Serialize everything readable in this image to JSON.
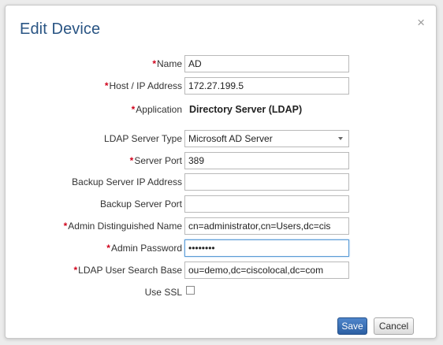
{
  "dialog": {
    "title": "Edit Device",
    "close_symbol": "×"
  },
  "required_marker": "*",
  "fields": {
    "name": {
      "label": "Name",
      "required": true,
      "value": "AD"
    },
    "host": {
      "label": "Host / IP Address",
      "required": true,
      "value": "172.27.199.5"
    },
    "application": {
      "label": "Application",
      "required": true,
      "value": "Directory Server (LDAP)"
    },
    "ldap_type": {
      "label": "LDAP Server Type",
      "required": false,
      "value": "Microsoft AD Server"
    },
    "server_port": {
      "label": "Server Port",
      "required": true,
      "value": "389"
    },
    "backup_ip": {
      "label": "Backup Server IP Address",
      "required": false,
      "value": ""
    },
    "backup_port": {
      "label": "Backup Server Port",
      "required": false,
      "value": ""
    },
    "admin_dn": {
      "label": "Admin Distinguished Name",
      "required": true,
      "value": "cn=administrator,cn=Users,dc=cis"
    },
    "admin_password": {
      "label": "Admin Password",
      "required": true,
      "value": "Passw0rd"
    },
    "search_base": {
      "label": "LDAP User Search Base",
      "required": true,
      "value": "ou=demo,dc=ciscolocal,dc=com"
    },
    "use_ssl": {
      "label": "Use SSL",
      "required": false,
      "checked": false
    }
  },
  "buttons": {
    "save": "Save",
    "cancel": "Cancel"
  },
  "colors": {
    "title": "#2a5584",
    "required": "#d0021b",
    "save_button": "#2c5fa3"
  }
}
